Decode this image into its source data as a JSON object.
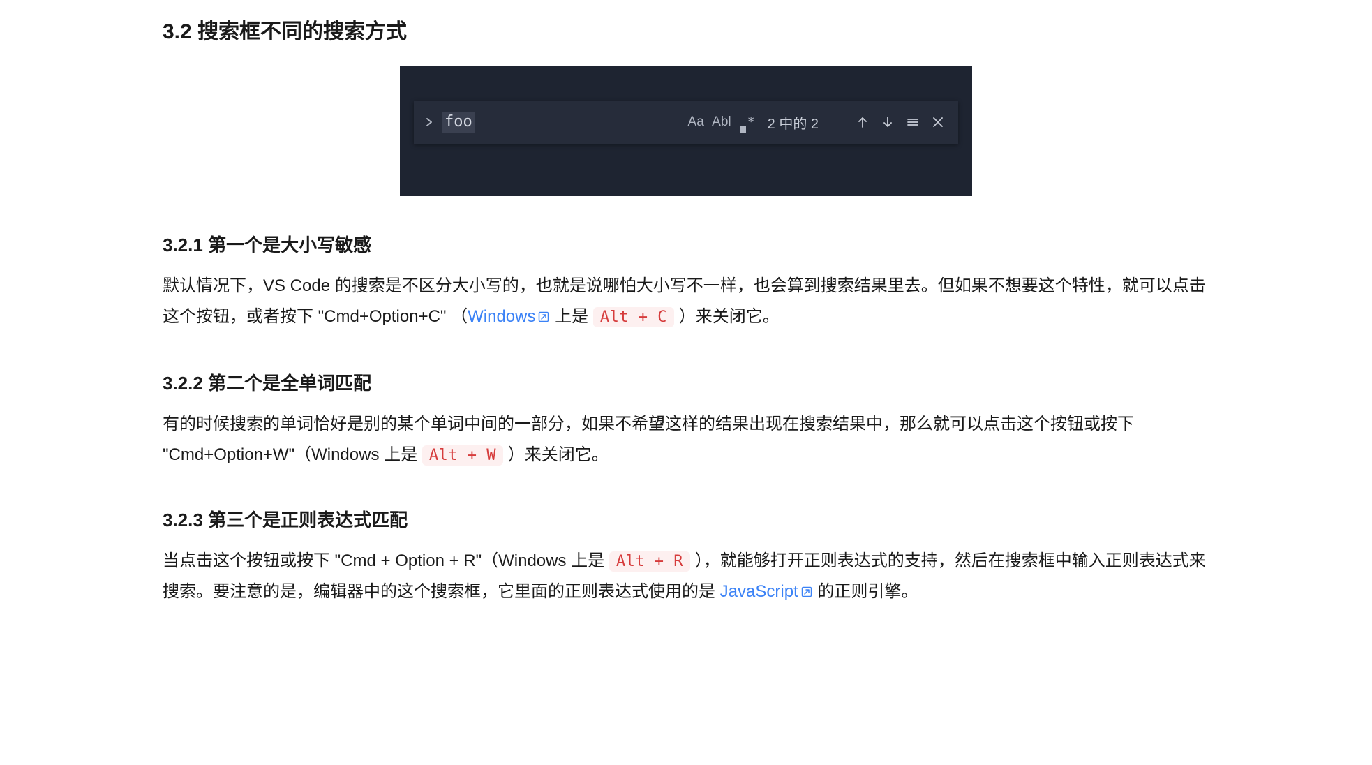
{
  "section": {
    "number": "3.2",
    "title": "搜索框不同的搜索方式"
  },
  "figure": {
    "search_text": "foo",
    "option_case_label": "Aa",
    "option_wholeword_label": "Abl",
    "result_count": "2 中的 2",
    "icons": {
      "toggle": "chevron-right",
      "case": "case-sensitive",
      "wholeword": "whole-word",
      "regex": "regex",
      "prev": "arrow-up",
      "next": "arrow-down",
      "menu": "hamburger",
      "close": "close"
    }
  },
  "sub1": {
    "number": "3.2.1",
    "title": "第一个是大小写敏感",
    "p_before_link": "默认情况下，VS Code 的搜索是不区分大小写的，也就是说哪怕大小写不一样，也会算到搜索结果里去。但如果不想要这个特性，就可以点击这个按钮，或者按下 \"Cmd+Option+C\" （",
    "link_text": "Windows",
    "p_after_link": " 上是 ",
    "kbd": "Alt + C",
    "p_tail": " ）来关闭它。"
  },
  "sub2": {
    "number": "3.2.2",
    "title": "第二个是全单词匹配",
    "p_before_kbd": "有的时候搜索的单词恰好是别的某个单词中间的一部分，如果不希望这样的结果出现在搜索结果中，那么就可以点击这个按钮或按下 \"Cmd+Option+W\"（Windows 上是 ",
    "kbd": "Alt + W",
    "p_tail": " ）来关闭它。"
  },
  "sub3": {
    "number": "3.2.3",
    "title": "第三个是正则表达式匹配",
    "p_before_kbd": "当点击这个按钮或按下 \"Cmd + Option + R\"（Windows 上是 ",
    "kbd": "Alt + R",
    "p_mid": " ），就能够打开正则表达式的支持，然后在搜索框中输入正则表达式来搜索。要注意的是，编辑器中的这个搜索框，它里面的正则表达式使用的是 ",
    "link_text": "JavaScript",
    "p_tail": " 的正则引擎。"
  }
}
